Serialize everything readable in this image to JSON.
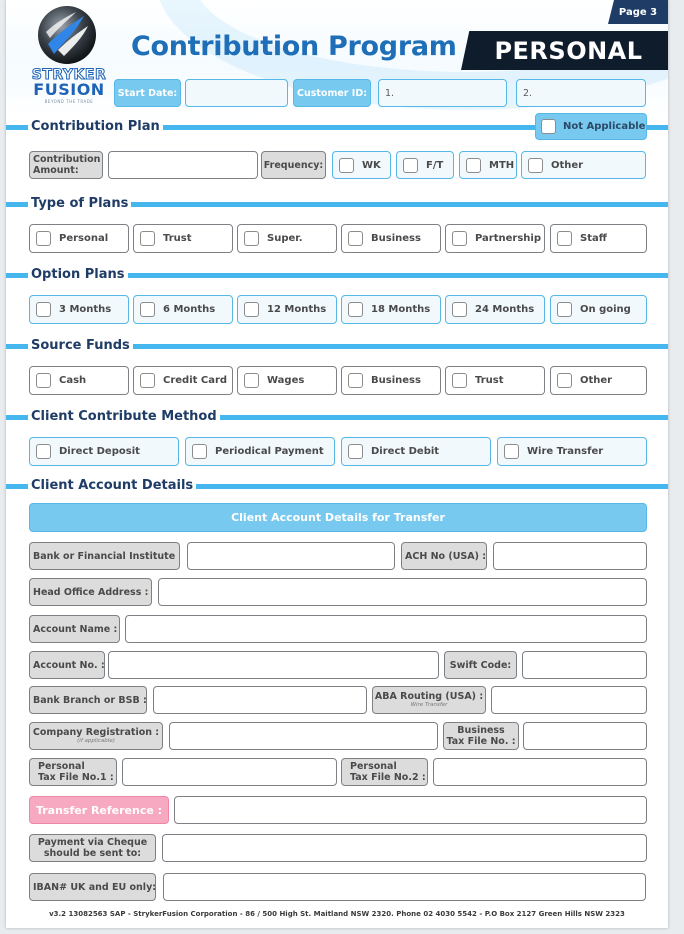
{
  "header": {
    "page_label": "Page 3",
    "title": "Contribution Program",
    "banner": "PERSONAL",
    "logo": {
      "line1": "STRYKER",
      "line2": "FUSION",
      "tagline": "BEYOND THE TRADE"
    },
    "start_date_label": "Start Date:",
    "customer_id_label": "Customer ID:",
    "customer_id_1": "1.",
    "customer_id_2": "2."
  },
  "contribution_plan": {
    "title": "Contribution Plan",
    "not_applicable": "Not Applicable",
    "amount_label_1": "Contribution",
    "amount_label_2": "Amount:",
    "frequency_label": "Frequency:",
    "frequency_options": [
      "WK",
      "F/T",
      "MTH",
      "Other"
    ]
  },
  "type_of_plans": {
    "title": "Type of Plans",
    "options": [
      "Personal",
      "Trust",
      "Super.",
      "Business",
      "Partnership",
      "Staff"
    ]
  },
  "option_plans": {
    "title": "Option Plans",
    "options": [
      "3 Months",
      "6 Months",
      "12 Months",
      "18 Months",
      "24 Months",
      "On going"
    ]
  },
  "source_funds": {
    "title": "Source Funds",
    "options": [
      "Cash",
      "Credit Card",
      "Wages",
      "Business",
      "Trust",
      "Other"
    ]
  },
  "contribute_method": {
    "title": "Client Contribute Method",
    "options": [
      "Direct Deposit",
      "Periodical Payment",
      "Direct Debit",
      "Wire Transfer"
    ]
  },
  "account_details": {
    "title": "Client Account Details",
    "bar": "Client Account Details for Transfer",
    "bank_institute": "Bank or Financial Institute :",
    "ach_no": "ACH No (USA) :",
    "head_office": "Head Office Address :",
    "account_name": "Account Name :",
    "account_no": "Account No. :",
    "swift_code": "Swift Code:",
    "bank_branch": "Bank Branch or BSB :",
    "aba_routing": "ABA Routing (USA) :",
    "aba_sub": "Wire Transfer",
    "company_reg": "Company Registration :",
    "company_reg_sub": "(if applicable)",
    "business_tfn_1": "Business",
    "business_tfn_2": "Tax File No. :",
    "personal_tfn1_1": "Personal",
    "personal_tfn1_2": "Tax File No.1 :",
    "personal_tfn2_1": "Personal",
    "personal_tfn2_2": "Tax File No.2 :",
    "transfer_reference": "Transfer Reference :",
    "cheque_1": "Payment via Cheque",
    "cheque_2": "should be sent to:",
    "iban": "IBAN# UK and EU only:"
  },
  "footer": "v3.2 13082563 SAP - StrykerFusion Corporation - 86 / 500 High St. Maitland NSW 2320. Phone  02 4030 5542 - P.O Box 2127 Green Hills NSW 2323",
  "colors": {
    "accent": "#45b6ee",
    "title_blue": "#1e6fb7",
    "navy": "#1f3c66",
    "pink": "#f6a9c0"
  }
}
